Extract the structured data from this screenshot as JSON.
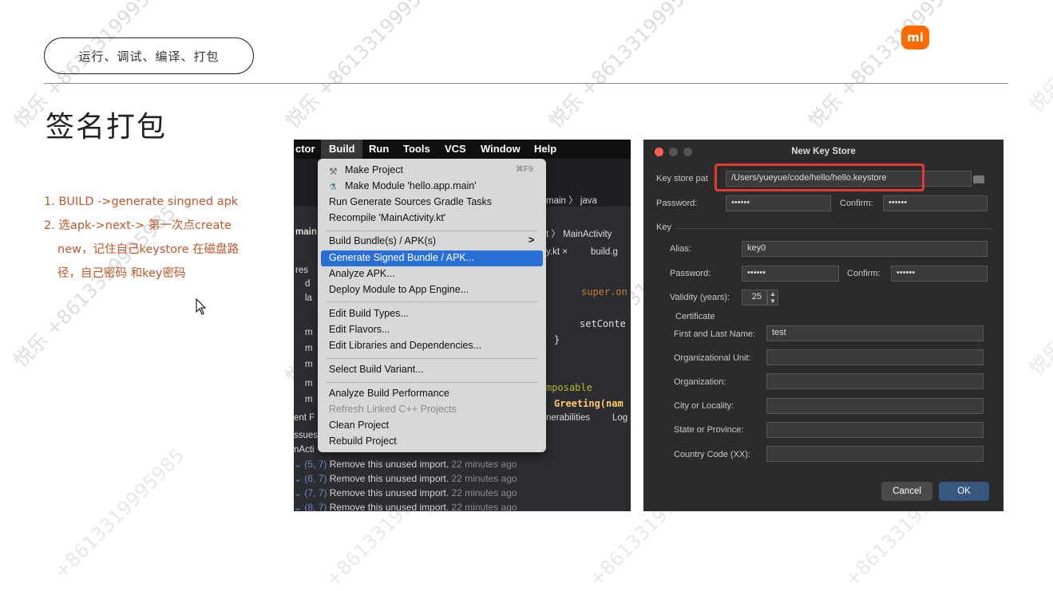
{
  "header": {
    "section_label": "运行、调试、编译、打包",
    "logo_text": "mi",
    "brand_color": "#ff6a00"
  },
  "page_title": "签名打包",
  "steps": {
    "step1": "1. BUILD ->generate singned apk",
    "step2_line1": "2. 选apk->next-> 第一次点create",
    "step2_line2": "new，记住自己keystore 在磁盘路",
    "step2_line3": "径，自己密码 和key密码"
  },
  "watermarks": {
    "a": "悦乐 +8613319995985",
    "b": "悦乐 +8613319995985",
    "c": "悦乐 +8613319995985",
    "d": "悦乐 +8613319995985",
    "e": "悦乐 +8613319995985",
    "f": "悦乐 +8613319995985",
    "g": "悦乐 +8613319995985",
    "h": "悦乐 +8613319995985",
    "i": "+8613319995985",
    "j": "+8613319995985",
    "k": "+8613319995985",
    "l": "+8613319995985",
    "m": "悦乐",
    "n": "悦乐"
  },
  "ide": {
    "menubar": {
      "m0": "ctor",
      "m1": "Build",
      "m2": "Run",
      "m3": "Tools",
      "m4": "VCS",
      "m5": "Window",
      "m6": "Help"
    },
    "background": {
      "main1": "main",
      "java_path": "main 〉 java",
      "t_main_activity": "t 〉 MainActivity",
      "ykt": "y.kt ×",
      "build_g": "build.g",
      "res": "res",
      "d": "d",
      "la": "la",
      "m1": "m",
      "m2": "m",
      "m3": "m",
      "m4": "m",
      "m5": "m",
      "ent_f": "ent F",
      "ssues": "ssues",
      "nacti": "nActi",
      "super_on": "super.on",
      "set_conte": "setConte",
      "brace": "}",
      "composable": "mposable",
      "greeting": "Greeting(nam",
      "nerabilities": "nerabilities",
      "log": "Log"
    },
    "menu": {
      "make_project": "Make Project",
      "make_project_shortcut": "⌘F9",
      "make_module": "Make Module 'hello.app.main'",
      "run_generate": "Run Generate Sources Gradle Tasks",
      "recompile": "Recompile 'MainActivity.kt'",
      "build_bundle": "Build Bundle(s) / APK(s)",
      "build_bundle_arrow": ">",
      "generate_signed": "Generate Signed Bundle / APK...",
      "analyze_apk": "Analyze APK...",
      "deploy_module": "Deploy Module to App Engine...",
      "edit_build_types": "Edit Build Types...",
      "edit_flavors": "Edit Flavors...",
      "edit_libraries": "Edit Libraries and Dependencies...",
      "select_variant": "Select Build Variant...",
      "analyze_perf": "Analyze Build Performance",
      "refresh_cpp": "Refresh Linked C++ Projects",
      "clean_project": "Clean Project",
      "rebuild_project": "Rebuild Project"
    },
    "issues": {
      "i1_pos": "(5, 7)",
      "i1_msg": "Remove this unused import.",
      "i1_ago": "22 minutes ago",
      "i2_pos": "(6, 7)",
      "i2_msg": "Remove this unused import.",
      "i2_ago": "22 minutes ago",
      "i3_pos": "(7, 7)",
      "i3_msg": "Remove this unused import.",
      "i3_ago": "22 minutes ago",
      "i4_pos": "(8, 7)",
      "i4_msg": "Remove this unused import.",
      "i4_ago": "22 minutes ago"
    }
  },
  "dialog": {
    "title": "New Key Store",
    "key_store_path_label": "Key store pat",
    "key_store_path_value": "/Users/yueyue/code/hello/hello.keystore",
    "password_label": "Password:",
    "password_value": "••••••",
    "confirm_label": "Confirm:",
    "confirm_value": "••••••",
    "key_section": "Key",
    "alias_label": "Alias:",
    "alias_value": "key0",
    "key_password_label": "Password:",
    "key_password_value": "••••••",
    "key_confirm_label": "Confirm:",
    "key_confirm_value": "••••••",
    "validity_label": "Validity (years):",
    "validity_value": "25",
    "certificate_label": "Certificate",
    "first_last_label": "First and Last Name:",
    "first_last_value": "test",
    "org_unit_label": "Organizational Unit:",
    "org_unit_value": "",
    "org_label": "Organization:",
    "org_value": "",
    "city_label": "City or Locality:",
    "city_value": "",
    "state_label": "State or Province:",
    "state_value": "",
    "country_label": "Country Code (XX):",
    "country_value": "",
    "cancel_label": "Cancel",
    "ok_label": "OK",
    "ok_color": "#365880"
  }
}
